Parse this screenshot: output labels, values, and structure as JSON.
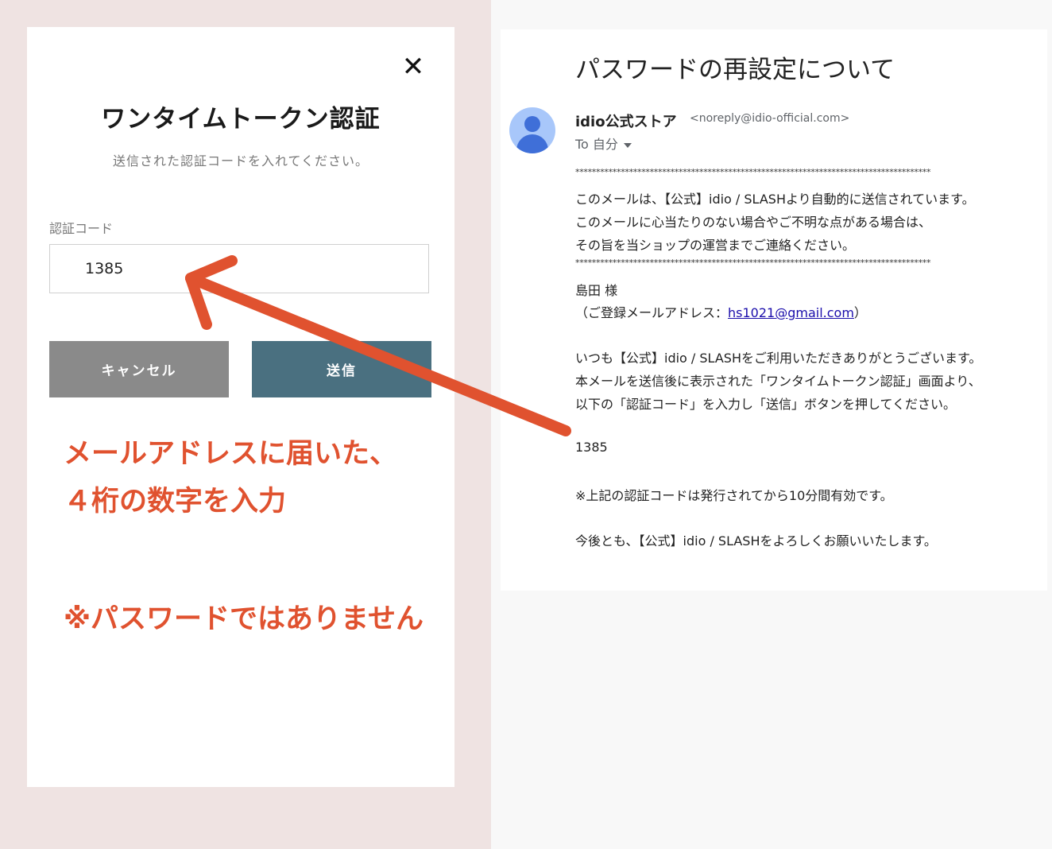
{
  "modal": {
    "close_glyph": "✕",
    "title": "ワンタイムトークン認証",
    "subtitle": "送信された認証コードを入れてください。",
    "field_label": "認証コード",
    "code_value": "1385",
    "cancel_label": "キャンセル",
    "send_label": "送信"
  },
  "annotations": {
    "line1": "メールアドレスに届いた、",
    "line2": "４桁の数字を入力",
    "note": "※パスワードではありません",
    "arrow_color": "#e0522f"
  },
  "email": {
    "subject": "パスワードの再設定について",
    "sender_name": "idio公式ストア",
    "sender_email": "<noreply@idio-official.com>",
    "to_label": "To 自分",
    "separator": "**************************************************************************************",
    "intro": [
      "このメールは、【公式】idio / SLASHより自動的に送信されています。",
      "このメールに心当たりのない場合やご不明な点がある場合は、",
      "その旨を当ショップの運営までご連絡ください。"
    ],
    "recipient": "島田 様",
    "address_prefix": "（ご登録メールアドレス：",
    "address_link": "hs1021@gmail.com",
    "address_suffix": "）",
    "body": [
      "いつも【公式】idio / SLASHをご利用いただきありがとうございます。",
      "本メールを送信後に表示された「ワンタイムトークン認証」画面より、",
      "以下の「認証コード」を入力し「送信」ボタンを押してください。"
    ],
    "code": "1385",
    "validity": "※上記の認証コードは発行されてから10分間有効です。",
    "closing": "今後とも、【公式】idio / SLASHをよろしくお願いいたします。"
  },
  "colors": {
    "left_background": "#efe3e2",
    "send_button": "#4a7080",
    "cancel_button": "#8a8a8a",
    "annotation": "#e0522f",
    "avatar_bg": "#a8c7fa",
    "avatar_fg": "#3f6fd8"
  }
}
